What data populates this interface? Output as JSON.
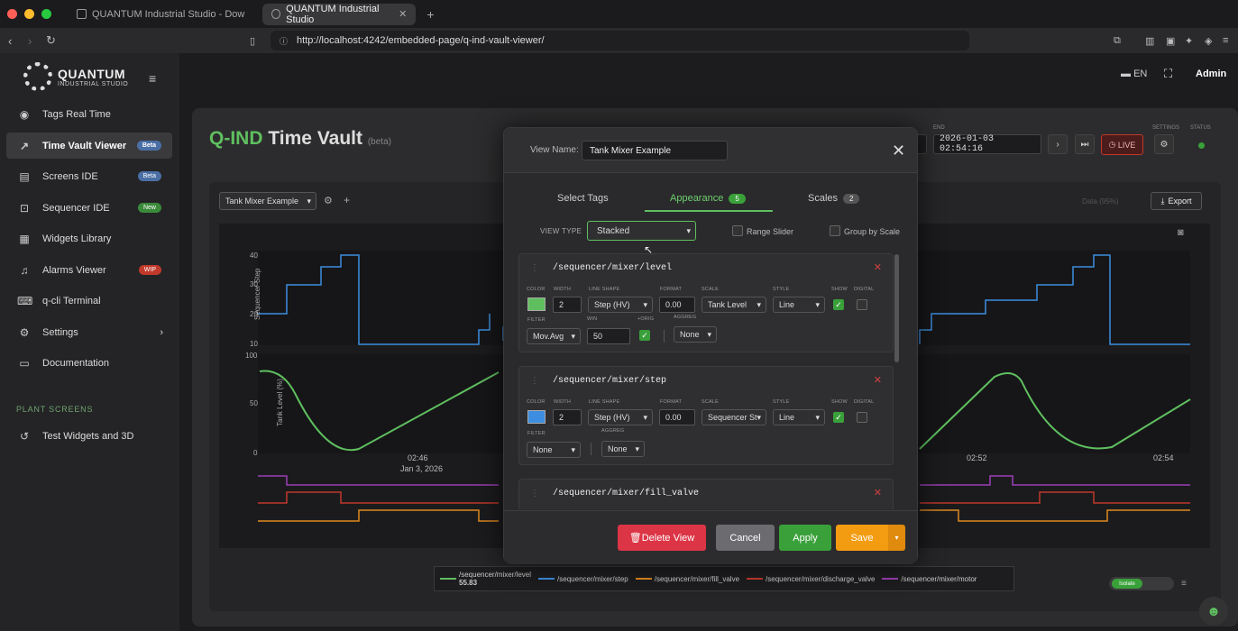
{
  "browser": {
    "tabs": [
      {
        "title": "QUANTUM Industrial Studio - Dow"
      },
      {
        "title": "QUANTUM Industrial Studio"
      }
    ],
    "url": "http://localhost:4242/embedded-page/q-ind-vault-viewer/"
  },
  "brand": {
    "name": "QUANTUM",
    "sub": "INDUSTRIAL STUDIO"
  },
  "sidebar": {
    "items": [
      {
        "label": "Tags Real Time",
        "icon": "eye-icon"
      },
      {
        "label": "Time Vault Viewer",
        "icon": "chart-icon",
        "badge": "Beta"
      },
      {
        "label": "Screens IDE",
        "icon": "screens-icon",
        "badge": "Beta"
      },
      {
        "label": "Sequencer IDE",
        "icon": "sequencer-icon",
        "badge": "New"
      },
      {
        "label": "Widgets Library",
        "icon": "library-icon"
      },
      {
        "label": "Alarms Viewer",
        "icon": "bell-icon",
        "badge": "WIP"
      },
      {
        "label": "q-cli Terminal",
        "icon": "terminal-icon"
      },
      {
        "label": "Settings",
        "icon": "gear-icon"
      },
      {
        "label": "Documentation",
        "icon": "book-icon"
      }
    ],
    "section": "PLANT SCREENS",
    "plant": [
      {
        "label": "Test Widgets and 3D"
      }
    ]
  },
  "header": {
    "lang": "EN",
    "user": "Admin"
  },
  "page": {
    "title_a": "Q-IND",
    "title_b": "Time Vault",
    "beta": "(beta)"
  },
  "toolbar": {
    "view": "Tank Mixer Example",
    "end_label": "END",
    "end_value": "2026-01-03 02:54:16",
    "live": "LIVE",
    "settings_label": "SETTINGS",
    "status_label": "STATUS",
    "export": "Export",
    "data_hint": "Data (95%)"
  },
  "chart_data": {
    "type": "line",
    "panels": [
      {
        "ylabel": "Sequencer Step",
        "yticks": [
          "40",
          "30",
          "20",
          "10"
        ],
        "ylim": [
          10,
          40
        ]
      },
      {
        "ylabel": "Tank Level (%)",
        "yticks": [
          "100",
          "50",
          "0"
        ],
        "ylim": [
          0,
          100
        ]
      }
    ],
    "xticks": [
      {
        "label": "02:46",
        "sub": "Jan 3, 2026"
      },
      {
        "label": "02:52"
      },
      {
        "label": "02:54"
      }
    ],
    "series": [
      {
        "name": "/sequencer/mixer/level",
        "color": "#5fbf5f",
        "last": "55.83"
      },
      {
        "name": "/sequencer/mixer/step",
        "color": "#3d8ee0"
      },
      {
        "name": "/sequencer/mixer/fill_valve",
        "color": "#e08a1e"
      },
      {
        "name": "/sequencer/mixer/discharge_valve",
        "color": "#c0392b"
      },
      {
        "name": "/sequencer/mixer/motor",
        "color": "#9b3fb5"
      }
    ]
  },
  "legend_toggle": "Isolate",
  "modal": {
    "view_name_label": "View Name:",
    "view_name": "Tank Mixer Example",
    "tabs": [
      {
        "label": "Select Tags"
      },
      {
        "label": "Appearance",
        "count": "5"
      },
      {
        "label": "Scales",
        "count": "2"
      }
    ],
    "view_type_label": "VIEW TYPE",
    "view_type": "Stacked",
    "range_slider": "Range Slider",
    "group_by_scale": "Group by Scale",
    "field_labels": {
      "color": "COLOR",
      "width": "WIDTH",
      "line_shape": "LINE SHAPE",
      "format": "FORMAT",
      "scale": "SCALE",
      "style": "STYLE",
      "show": "SHOW",
      "digital": "DIGITAL",
      "filter": "FILTER",
      "win": "WIN",
      "orig": "+ORIG",
      "aggreg": "AGGREG"
    },
    "tags": [
      {
        "path": "/sequencer/mixer/level",
        "color": "#5fbf5f",
        "width": "2",
        "shape": "Step (HV)",
        "format": "0.00",
        "scale": "Tank Level",
        "style": "Line",
        "filter": "Mov.Avg",
        "win": "50",
        "aggreg": "None"
      },
      {
        "path": "/sequencer/mixer/step",
        "color": "#3d8ee0",
        "width": "2",
        "shape": "Step (HV)",
        "format": "0.00",
        "scale": "Sequencer St",
        "style": "Line",
        "filter": "None",
        "aggreg": "None"
      },
      {
        "path": "/sequencer/mixer/fill_valve"
      }
    ],
    "buttons": {
      "delete": "Delete View",
      "cancel": "Cancel",
      "apply": "Apply",
      "save": "Save"
    }
  }
}
